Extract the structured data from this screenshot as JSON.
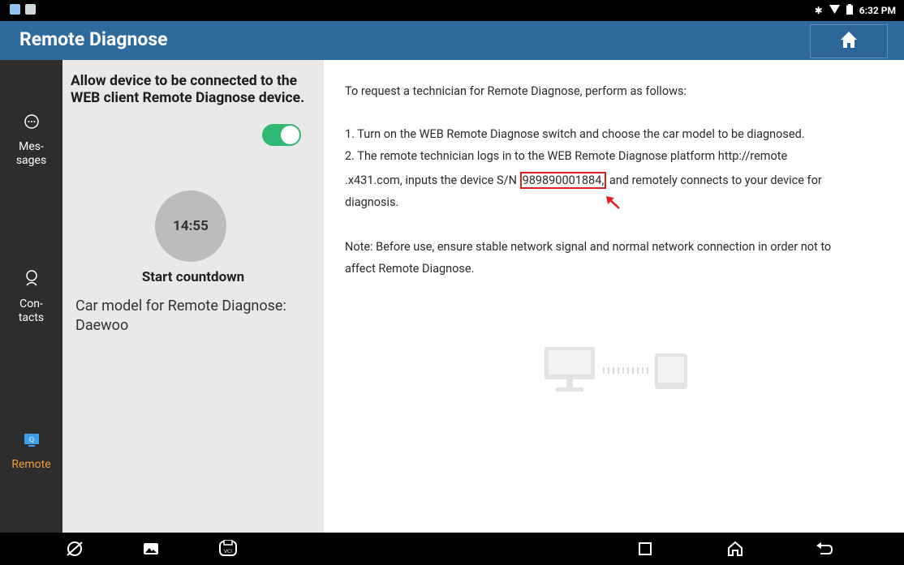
{
  "status_bar": {
    "time": "6:32 PM"
  },
  "header": {
    "title": "Remote Diagnose"
  },
  "nav": {
    "items": [
      {
        "label_line1": "Mes-",
        "label_line2": "sages"
      },
      {
        "label_line1": "Con-",
        "label_line2": "tacts"
      },
      {
        "label": "Remote"
      }
    ]
  },
  "panel": {
    "allow_text": "Allow device to be connected to the WEB client Remote Diagnose device.",
    "toggle_on": true,
    "timer": "14:55",
    "countdown_label": "Start countdown",
    "car_model_label": "Car model for Remote Diagnose:",
    "car_model_value": "Daewoo"
  },
  "content": {
    "intro": "To request a technician for Remote Diagnose, perform as follows:",
    "step1": "1. Turn on the WEB Remote Diagnose switch and choose the car model to be diagnosed.",
    "step2_line1": "2. The remote technician logs in to the WEB Remote Diagnose platform http://remote",
    "step2_line2_pre": ".x431.com, inputs the device S/N ",
    "serial_number": "989890001884,",
    "step2_line2_post": " and remotely connects to your device for",
    "step2_line3": "diagnosis.",
    "note_line1": "Note: Before use, ensure stable network signal and normal network connection in order not to",
    "note_line2": "affect Remote Diagnose."
  },
  "colors": {
    "header": "#2f6a9d",
    "accent": "#f39c3d",
    "toggle": "#2eb872",
    "highlight": "#e02020"
  }
}
